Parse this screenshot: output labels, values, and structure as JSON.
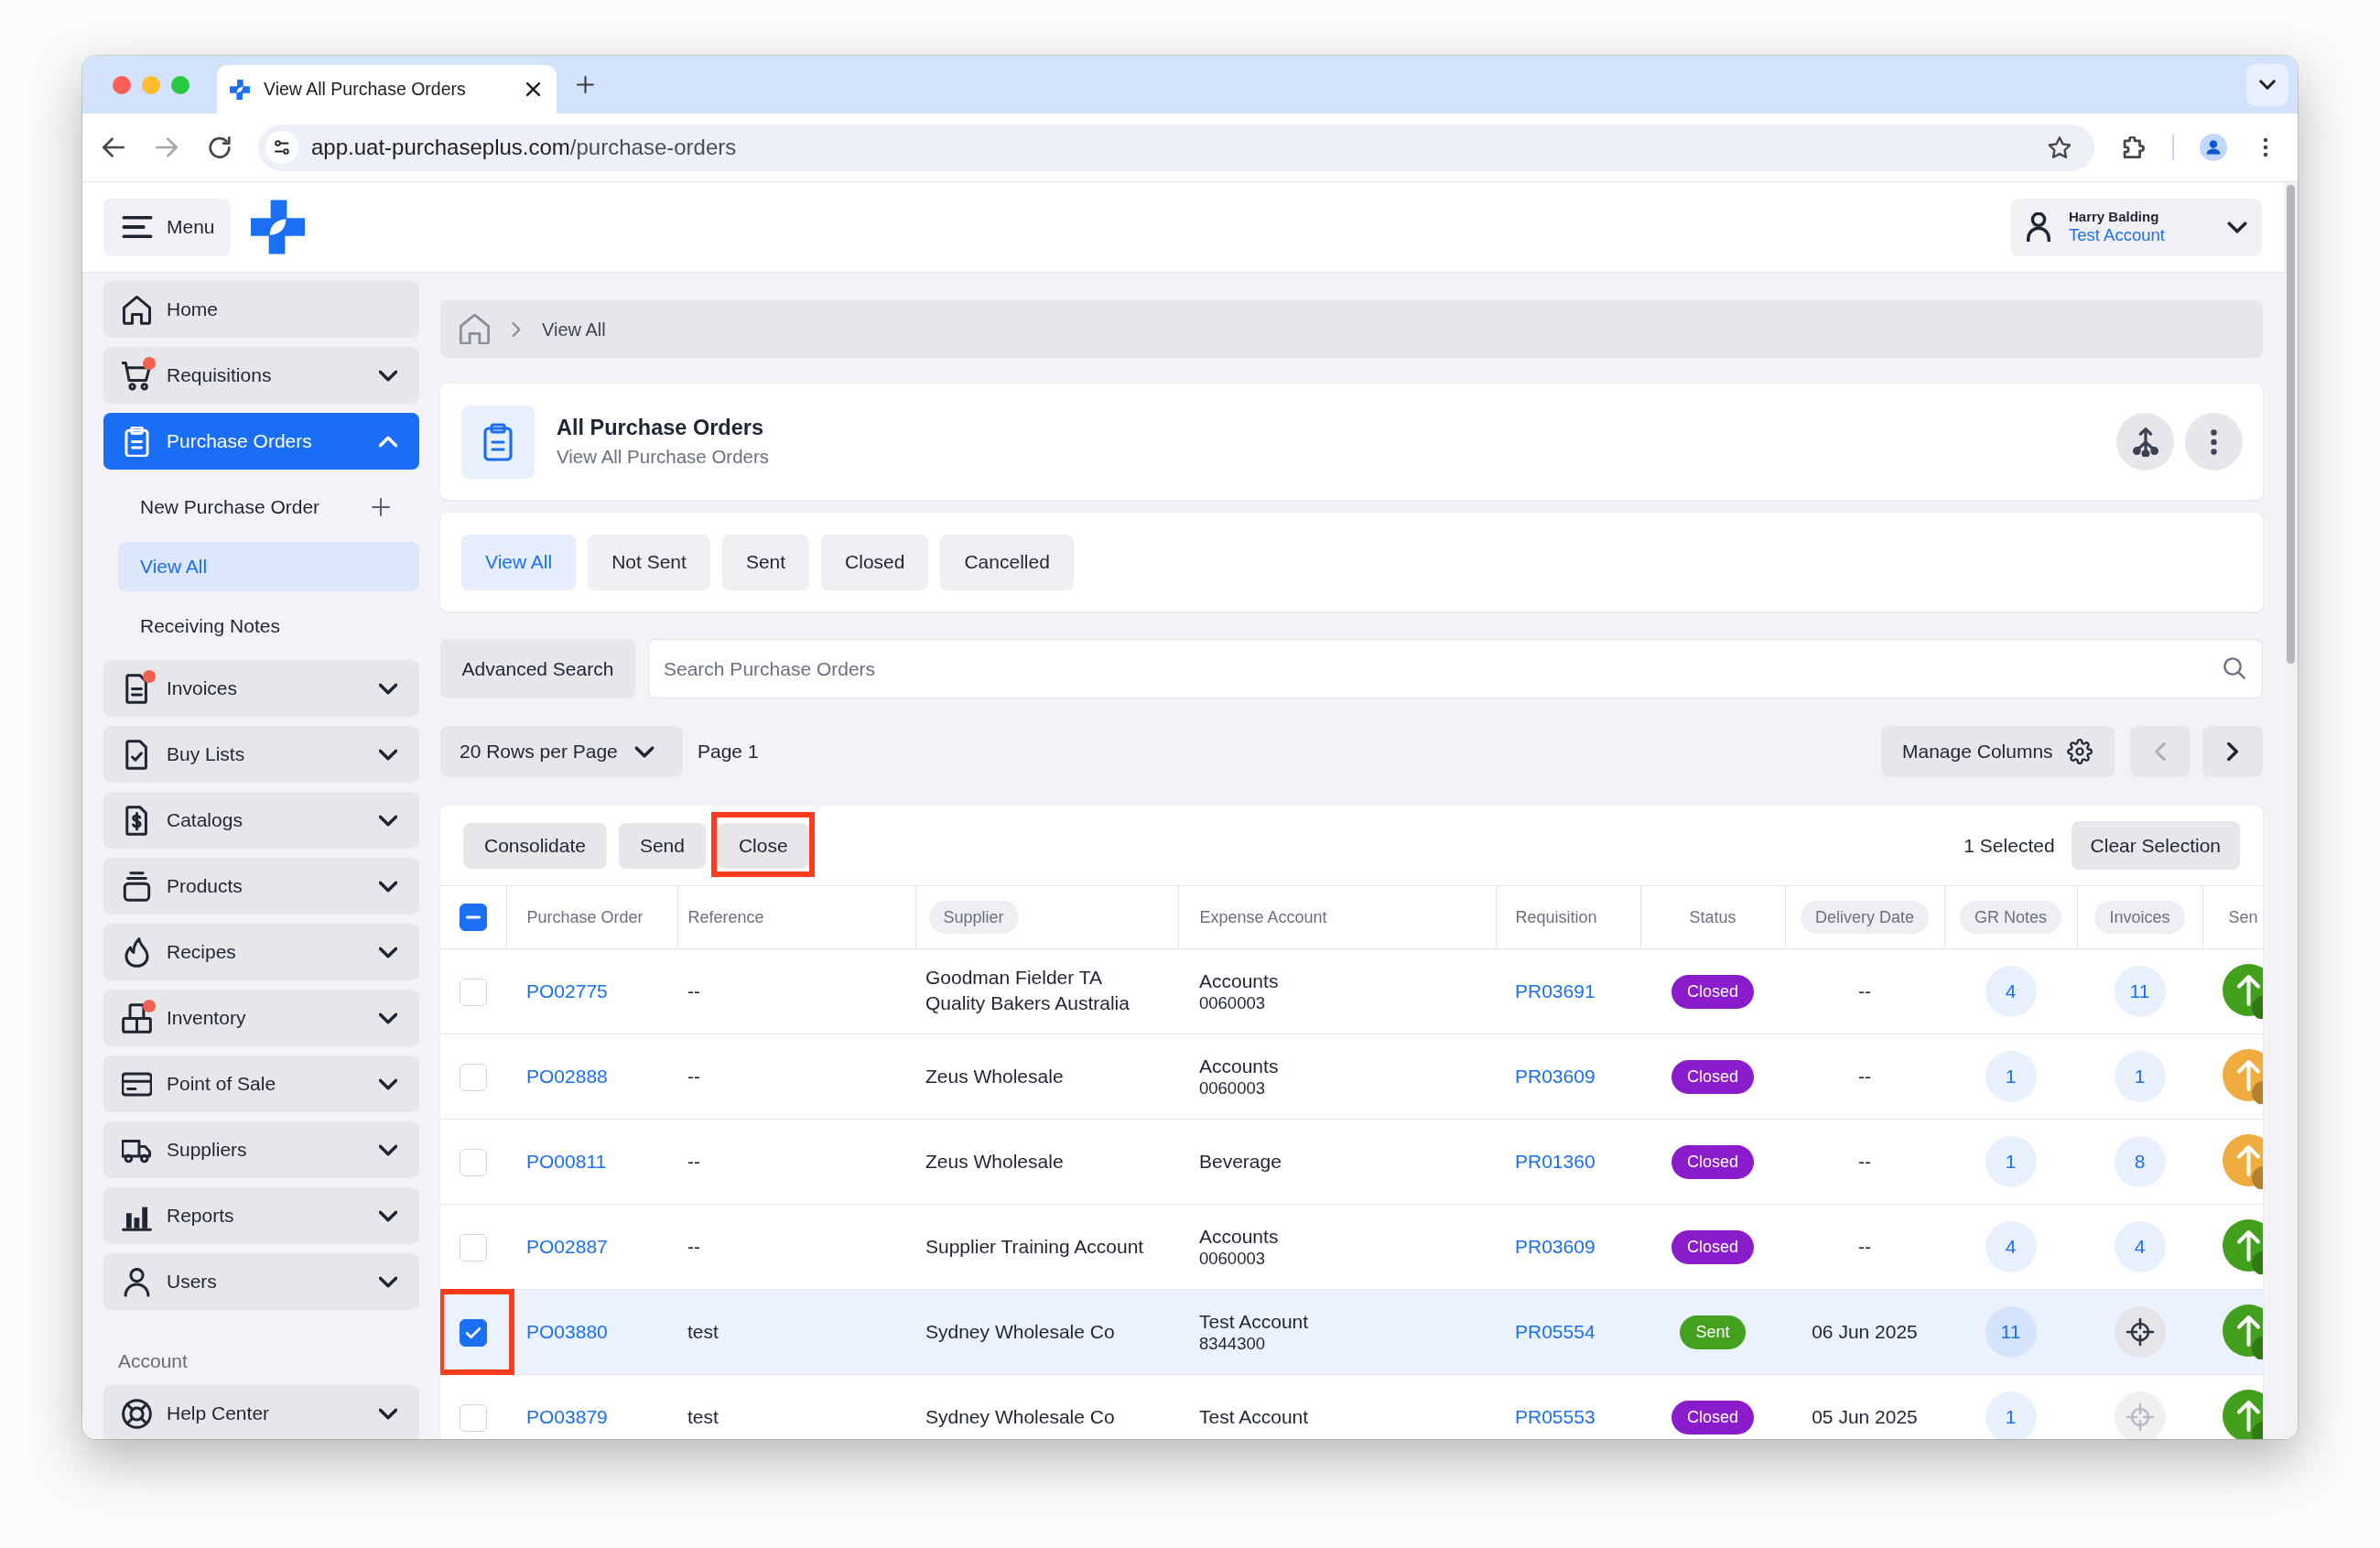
{
  "browser": {
    "tab_title": "View All Purchase Orders",
    "url_host": "app.uat-purchaseplus.com",
    "url_path": "/purchase-orders"
  },
  "header": {
    "menu_label": "Menu",
    "user_name": "Harry Balding",
    "user_account": "Test Account"
  },
  "sidebar": {
    "items": [
      {
        "label": "Home",
        "kind": "link",
        "alert": false,
        "selected": false
      },
      {
        "label": "Requisitions",
        "kind": "group",
        "alert": true,
        "selected": false,
        "expanded": false
      },
      {
        "label": "Purchase Orders",
        "kind": "group",
        "alert": false,
        "selected": true,
        "expanded": true,
        "children": [
          {
            "label": "New Purchase Order",
            "kind": "create",
            "selected": false
          },
          {
            "label": "View All",
            "kind": "link",
            "selected": true
          },
          {
            "label": "Receiving Notes",
            "kind": "link",
            "selected": false
          }
        ]
      },
      {
        "label": "Invoices",
        "kind": "group",
        "alert": true,
        "selected": false,
        "expanded": false
      },
      {
        "label": "Buy Lists",
        "kind": "group",
        "alert": false,
        "selected": false,
        "expanded": false
      },
      {
        "label": "Catalogs",
        "kind": "group",
        "alert": false,
        "selected": false,
        "expanded": false
      },
      {
        "label": "Products",
        "kind": "group",
        "alert": false,
        "selected": false,
        "expanded": false
      },
      {
        "label": "Recipes",
        "kind": "group",
        "alert": false,
        "selected": false,
        "expanded": false
      },
      {
        "label": "Inventory",
        "kind": "group",
        "alert": true,
        "selected": false,
        "expanded": false
      },
      {
        "label": "Point of Sale",
        "kind": "group",
        "alert": false,
        "selected": false,
        "expanded": false
      },
      {
        "label": "Suppliers",
        "kind": "group",
        "alert": false,
        "selected": false,
        "expanded": false
      },
      {
        "label": "Reports",
        "kind": "group",
        "alert": false,
        "selected": false,
        "expanded": false
      },
      {
        "label": "Users",
        "kind": "group",
        "alert": false,
        "selected": false,
        "expanded": false
      }
    ],
    "section_label": "Account",
    "account_items": [
      {
        "label": "Help Center",
        "kind": "group",
        "alert": false,
        "selected": false,
        "expanded": false
      }
    ]
  },
  "breadcrumb": {
    "current": "View All"
  },
  "page_header": {
    "title": "All Purchase Orders",
    "subtitle": "View All Purchase Orders"
  },
  "filter_tabs": [
    {
      "label": "View All",
      "selected": true
    },
    {
      "label": "Not Sent",
      "selected": false
    },
    {
      "label": "Sent",
      "selected": false
    },
    {
      "label": "Closed",
      "selected": false
    },
    {
      "label": "Cancelled",
      "selected": false
    }
  ],
  "search": {
    "advanced_label": "Advanced Search",
    "placeholder": "Search Purchase Orders"
  },
  "pagination": {
    "rows_per_page": "20 Rows per Page",
    "page": "Page 1",
    "manage_columns": "Manage Columns",
    "previous_disabled": true,
    "next_disabled": false
  },
  "bulk_actions": [
    {
      "label": "Consolidate",
      "highlighted": false
    },
    {
      "label": "Send",
      "highlighted": false
    },
    {
      "label": "Close",
      "highlighted": true
    }
  ],
  "selection": {
    "count": "1 Selected",
    "clear_label": "Clear Selection"
  },
  "table": {
    "select_all_indeterminate": true,
    "columns": [
      {
        "label": "Purchase Order",
        "sortable": false
      },
      {
        "label": "Reference",
        "sortable": false
      },
      {
        "label": "Supplier",
        "sortable": true
      },
      {
        "label": "Expense Account",
        "sortable": false
      },
      {
        "label": "Requisition",
        "sortable": false
      },
      {
        "label": "Status",
        "sortable": false
      },
      {
        "label": "Delivery Date",
        "sortable": true
      },
      {
        "label": "GR Notes",
        "sortable": true
      },
      {
        "label": "Invoices",
        "sortable": true
      },
      {
        "label": "Sen",
        "sortable": false
      }
    ],
    "rows": [
      {
        "selected": false,
        "highlighted": false,
        "purchase_order": "PO02775",
        "reference": "--",
        "supplier": "Goodman Fielder TA Quality Bakers Australia",
        "expense_account": "Accounts",
        "expense_code": "0060003",
        "requisition": "PR03691",
        "status": {
          "label": "Closed",
          "color": "#8a1ccb"
        },
        "delivery_date": "--",
        "gr_notes": "4",
        "invoices": {
          "kind": "count",
          "value": "11"
        },
        "send": {
          "color": "#43a01c"
        }
      },
      {
        "selected": false,
        "highlighted": false,
        "purchase_order": "PO02888",
        "reference": "--",
        "supplier": "Zeus Wholesale",
        "expense_account": "Accounts",
        "expense_code": "0060003",
        "requisition": "PR03609",
        "status": {
          "label": "Closed",
          "color": "#8a1ccb"
        },
        "delivery_date": "--",
        "gr_notes": "1",
        "invoices": {
          "kind": "count",
          "value": "1"
        },
        "send": {
          "color": "#efad3f"
        }
      },
      {
        "selected": false,
        "highlighted": false,
        "purchase_order": "PO00811",
        "reference": "--",
        "supplier": "Zeus Wholesale",
        "expense_account": "Beverage",
        "requisition": "PR01360",
        "status": {
          "label": "Closed",
          "color": "#8a1ccb"
        },
        "delivery_date": "--",
        "gr_notes": "1",
        "invoices": {
          "kind": "count",
          "value": "8"
        },
        "send": {
          "color": "#efad3f"
        }
      },
      {
        "selected": false,
        "highlighted": false,
        "purchase_order": "PO02887",
        "reference": "--",
        "supplier": "Supplier Training Account",
        "expense_account": "Accounts",
        "expense_code": "0060003",
        "requisition": "PR03609",
        "status": {
          "label": "Closed",
          "color": "#8a1ccb"
        },
        "delivery_date": "--",
        "gr_notes": "4",
        "invoices": {
          "kind": "count",
          "value": "4"
        },
        "send": {
          "color": "#43a01c"
        }
      },
      {
        "selected": true,
        "highlighted": true,
        "purchase_order": "PO03880",
        "reference": "test",
        "supplier": "Sydney Wholesale Co",
        "expense_account": "Test Account",
        "expense_code": "8344300",
        "requisition": "PR05554",
        "status": {
          "label": "Sent",
          "color": "#44a11d"
        },
        "delivery_date": "06 Jun 2025",
        "gr_notes": "11",
        "invoices": {
          "kind": "locate",
          "dimmed": false
        },
        "send": {
          "color": "#43a01c"
        }
      },
      {
        "selected": false,
        "highlighted": false,
        "purchase_order": "PO03879",
        "reference": "test",
        "supplier": "Sydney Wholesale Co",
        "expense_account": "Test Account",
        "requisition": "PR05553",
        "status": {
          "label": "Closed",
          "color": "#8a1ccb"
        },
        "delivery_date": "05 Jun 2025",
        "gr_notes": "1",
        "invoices": {
          "kind": "locate",
          "dimmed": true
        },
        "send": {
          "color": "#43a01c"
        }
      }
    ]
  }
}
